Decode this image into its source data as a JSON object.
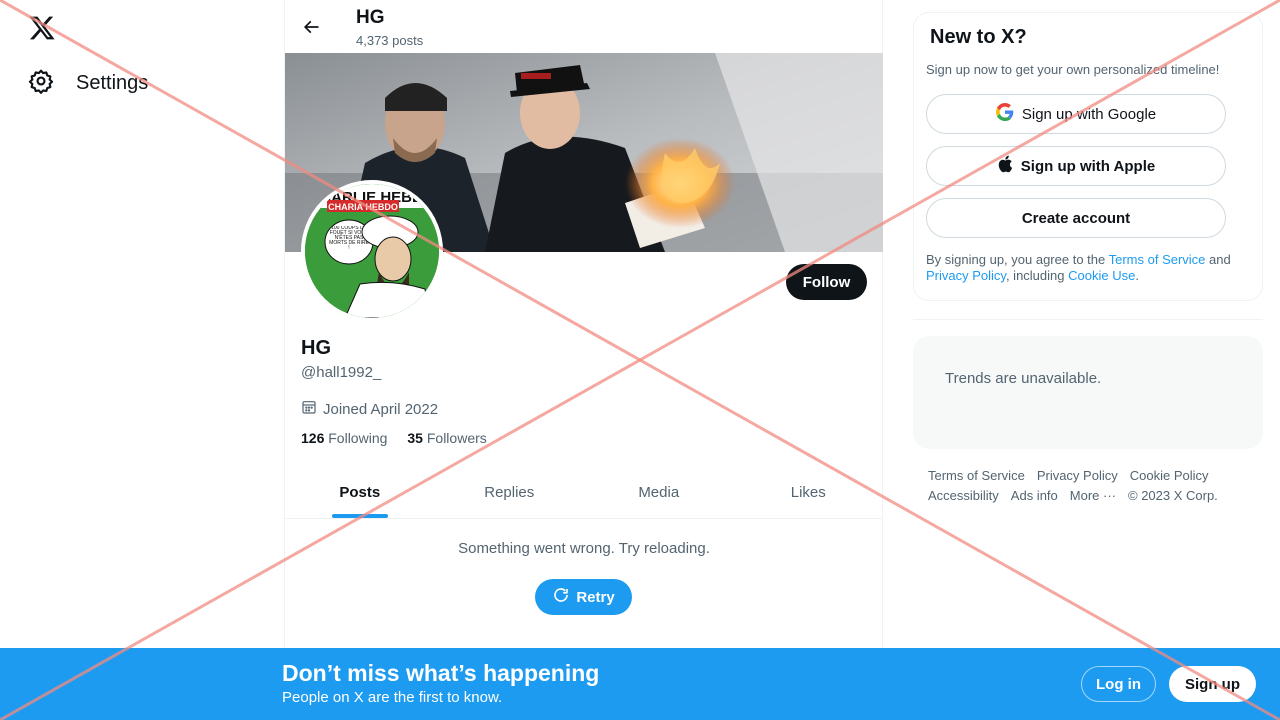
{
  "nav": {
    "settings_label": "Settings"
  },
  "header": {
    "title": "HG",
    "post_count": "4,373 posts"
  },
  "profile": {
    "name": "HG",
    "handle": "@hall1992_",
    "joined": "Joined April 2022",
    "following_count": "126",
    "following_label": "Following",
    "followers_count": "35",
    "followers_label": "Followers",
    "follow_label": "Follow",
    "avatar_text": {
      "masthead": "CHARLIE HEBDO",
      "subtitle": "CHARIA HEBDO",
      "speech": "100 COUPS DE FOUET SI VOUS N'ÊTES PAS MORTS DE RIRE !"
    }
  },
  "tabs": [
    {
      "label": "Posts",
      "active": true
    },
    {
      "label": "Replies",
      "active": false
    },
    {
      "label": "Media",
      "active": false
    },
    {
      "label": "Likes",
      "active": false
    }
  ],
  "feed": {
    "error_text": "Something went wrong. Try reloading.",
    "retry_label": "Retry"
  },
  "signup_card": {
    "title": "New to X?",
    "subtitle": "Sign up now to get your own personalized timeline!",
    "google_label": "Sign up with Google",
    "apple_label": "Sign up with Apple",
    "create_label": "Create account",
    "terms_prefix": "By signing up, you agree to the ",
    "terms_link": "Terms of Service",
    "terms_and": " and ",
    "privacy_link": "Privacy Policy",
    "terms_including": ", including ",
    "cookie_link": "Cookie Use",
    "terms_end": "."
  },
  "trends": {
    "text": "Trends are unavailable."
  },
  "footer": {
    "row1": [
      "Terms of Service",
      "Privacy Policy",
      "Cookie Policy"
    ],
    "row2": [
      "Accessibility",
      "Ads info",
      "More ···"
    ],
    "copyright": "© 2023 X Corp."
  },
  "bottom_bar": {
    "title": "Don’t miss what’s happening",
    "subtitle": "People on X are the first to know.",
    "login_label": "Log in",
    "signup_label": "Sign up"
  },
  "colors": {
    "accent": "#1d9bf0",
    "dark": "#0f1419",
    "muted": "#536471",
    "overlay_cross": "#f28b82"
  },
  "icons": [
    "x-logo-icon",
    "gear-icon",
    "back-arrow-icon",
    "calendar-icon",
    "refresh-icon",
    "google-icon",
    "apple-icon"
  ]
}
